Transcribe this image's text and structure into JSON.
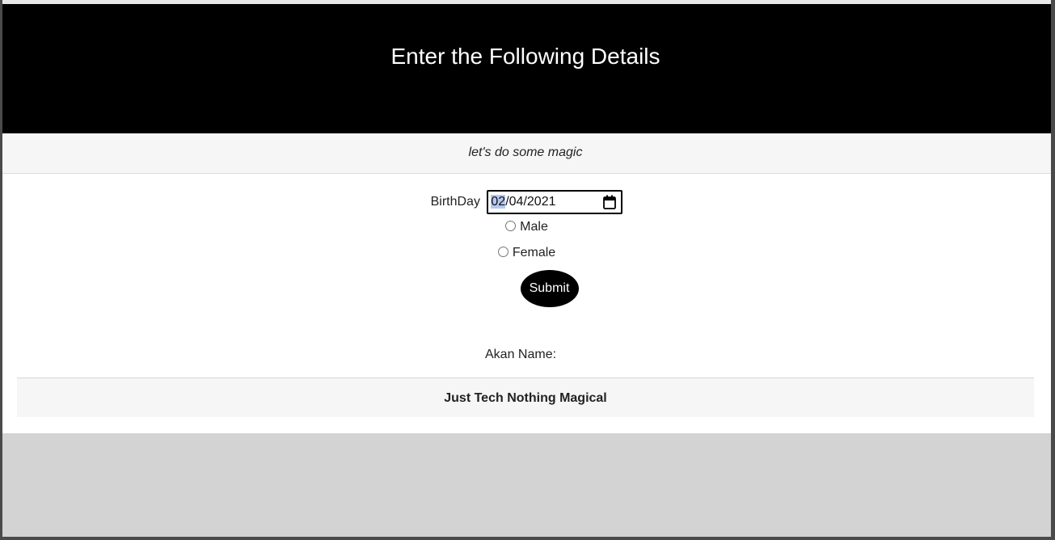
{
  "header": {
    "title": "Enter the Following Details"
  },
  "tagline": "let's do some magic",
  "form": {
    "birthday_label": "BirthDay",
    "birthday_value": {
      "month": "02",
      "rest": "/04/2021"
    },
    "calendar_icon": "calendar-icon",
    "gender_options": [
      "Male",
      "Female"
    ],
    "selected_gender": "",
    "submit_label": "Submit"
  },
  "result": {
    "akan_label": "Akan Name:",
    "akan_value": ""
  },
  "footer": {
    "text": "Just Tech Nothing Magical"
  },
  "colors": {
    "header_bg": "#000000",
    "header_text": "#ffffff",
    "band_bg": "#f6f6f6",
    "outer_bg": "#d3d3d3",
    "date_selection": "#b4c8f0"
  }
}
